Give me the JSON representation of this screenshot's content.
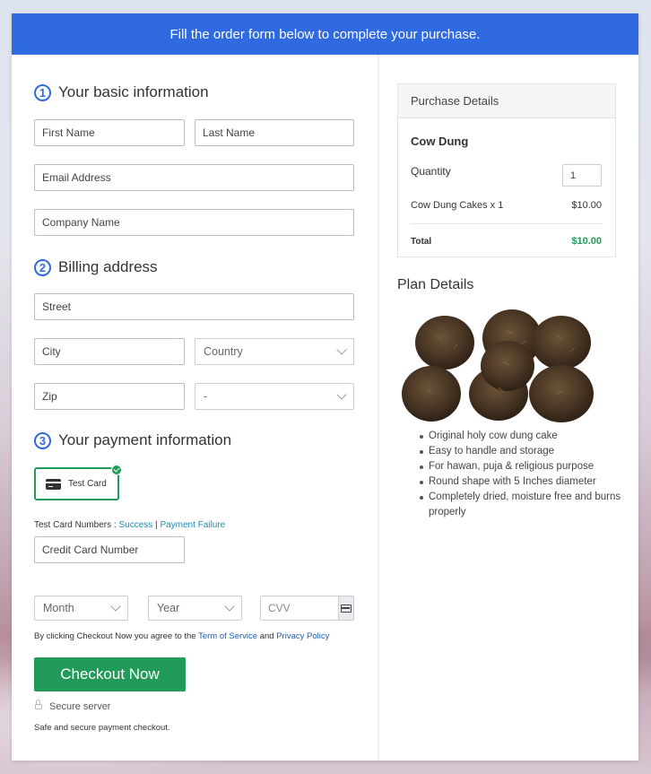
{
  "banner": "Fill the order form below to complete your purchase.",
  "sections": [
    {
      "num": "1",
      "title": "Your basic information"
    },
    {
      "num": "2",
      "title": "Billing address"
    },
    {
      "num": "3",
      "title": "Your payment information"
    }
  ],
  "basic": {
    "first_name": "First Name",
    "last_name": "Last Name",
    "email": "Email Address",
    "company": "Company Name"
  },
  "billing": {
    "street": "Street",
    "city": "City",
    "country": "Country",
    "zip": "Zip",
    "state": "-"
  },
  "payment": {
    "test_card_label": "Test Card",
    "test_numbers_prefix": "Test Card Numbers : ",
    "success_link": "Success",
    "separator": " | ",
    "failure_link": "Payment Failure",
    "card_number": "Credit Card Number",
    "month": "Month",
    "year": "Year",
    "cvv": "CVV"
  },
  "terms": {
    "prefix": "By clicking Checkout Now you agree to the ",
    "tos_link": "Term of Service",
    "and": " and ",
    "privacy_link": "Privacy Policy"
  },
  "checkout_button": "Checkout Now",
  "secure_server": "Secure server",
  "safe_text": "Safe and secure payment checkout.",
  "purchase": {
    "header": "Purchase Details",
    "product": "Cow Dung",
    "quantity_label": "Quantity",
    "quantity_value": "1",
    "item_label": "Cow Dung Cakes x 1",
    "item_price": "$10.00",
    "total_label": "Total",
    "total_value": "$10.00"
  },
  "plan": {
    "title": "Plan Details",
    "features": [
      "Original holy cow dung cake",
      "Easy to handle and storage",
      "For hawan, puja & religious purpose",
      "Round shape with 5 Inches diameter",
      "Completely dried, moisture free and burns properly"
    ]
  },
  "colors": {
    "accent": "#2f6ae1",
    "success": "#219a5a",
    "link": "#1c8fb5"
  }
}
